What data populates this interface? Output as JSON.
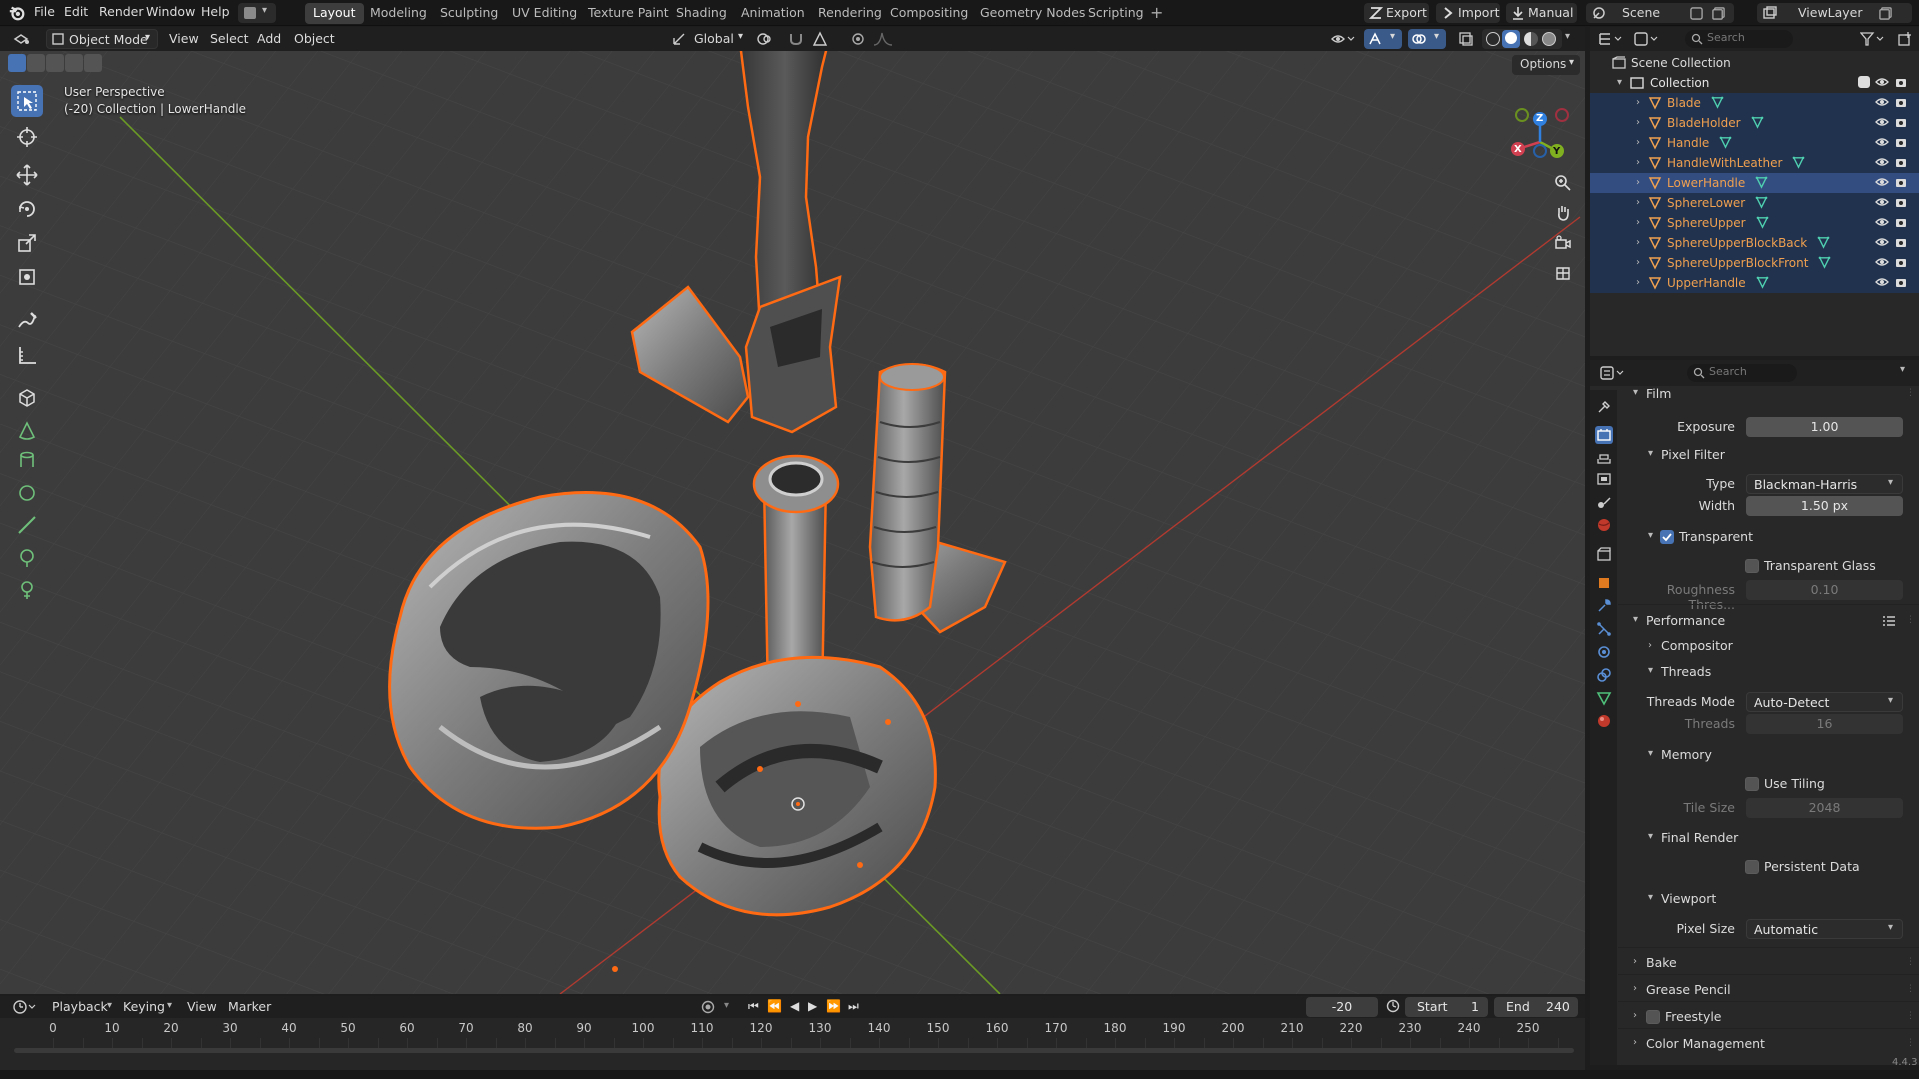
{
  "app": {
    "name": "Blender",
    "version": "4.4.3"
  },
  "menu": [
    "File",
    "Edit",
    "Render",
    "Window",
    "Help"
  ],
  "workspaces": [
    {
      "label": "Layout",
      "active": true
    },
    {
      "label": "Modeling"
    },
    {
      "label": "Sculpting"
    },
    {
      "label": "UV Editing"
    },
    {
      "label": "Texture Paint"
    },
    {
      "label": "Shading"
    },
    {
      "label": "Animation"
    },
    {
      "label": "Rendering"
    },
    {
      "label": "Compositing"
    },
    {
      "label": "Geometry Nodes"
    },
    {
      "label": "Scripting"
    }
  ],
  "topright": {
    "export": "Export",
    "import": "Import",
    "manual": "Manual",
    "scene": "Scene",
    "view_layer": "ViewLayer"
  },
  "viewport_header": {
    "mode": "Object Mode",
    "menus": [
      "View",
      "Select",
      "Add",
      "Object"
    ],
    "orientation": "Global",
    "options": "Options"
  },
  "viewport": {
    "view_name": "User Perspective",
    "context": "(-20) Collection | LowerHandle",
    "gizmo": {
      "x": "X",
      "y": "Y",
      "z": "Z"
    }
  },
  "outliner": {
    "search_placeholder": "Search",
    "scene_collection": "Scene Collection",
    "collection": "Collection",
    "objects": [
      {
        "name": "Blade",
        "active": false
      },
      {
        "name": "BladeHolder",
        "active": false
      },
      {
        "name": "Handle",
        "active": false
      },
      {
        "name": "HandleWithLeather",
        "active": false
      },
      {
        "name": "LowerHandle",
        "active": true
      },
      {
        "name": "SphereLower",
        "active": false
      },
      {
        "name": "SphereUpper",
        "active": false
      },
      {
        "name": "SphereUpperBlockBack",
        "active": false
      },
      {
        "name": "SphereUpperBlockFront",
        "active": false
      },
      {
        "name": "UpperHandle",
        "active": false
      }
    ]
  },
  "properties": {
    "search_placeholder": "Search",
    "film": {
      "title": "Film",
      "exposure_label": "Exposure",
      "exposure_value": "1.00",
      "pixel_filter": "Pixel Filter",
      "type_label": "Type",
      "type_value": "Blackman-Harris",
      "width_label": "Width",
      "width_value": "1.50 px",
      "transparent": "Transparent",
      "transparent_glass": "Transparent Glass",
      "roughness_label": "Roughness Thres...",
      "roughness_value": "0.10"
    },
    "performance": {
      "title": "Performance",
      "compositor": "Compositor",
      "threads": "Threads",
      "threads_mode_label": "Threads Mode",
      "threads_mode_value": "Auto-Detect",
      "threads_label": "Threads",
      "threads_value": "16",
      "memory": "Memory",
      "use_tiling": "Use Tiling",
      "tile_size_label": "Tile Size",
      "tile_size_value": "2048",
      "final_render": "Final Render",
      "persistent_data": "Persistent Data",
      "viewport": "Viewport",
      "pixel_size_label": "Pixel Size",
      "pixel_size_value": "Automatic"
    },
    "bake": "Bake",
    "grease_pencil": "Grease Pencil",
    "freestyle": "Freestyle",
    "color_management": "Color Management"
  },
  "timeline": {
    "menus": [
      "Playback",
      "Keying",
      "View",
      "Marker"
    ],
    "current_frame": "-20",
    "start_label": "Start",
    "start_value": "1",
    "end_label": "End",
    "end_value": "240",
    "ticks": [
      "0",
      "10",
      "20",
      "30",
      "40",
      "50",
      "60",
      "70",
      "80",
      "90",
      "100",
      "110",
      "120",
      "130",
      "140",
      "150",
      "160",
      "170",
      "180",
      "190",
      "200",
      "210",
      "220",
      "230",
      "240",
      "250"
    ]
  },
  "colors": {
    "accent": "#4772b3",
    "selection_outline": "#ff6a13",
    "x_axis": "#c0392b",
    "y_axis": "#6b9a25"
  }
}
